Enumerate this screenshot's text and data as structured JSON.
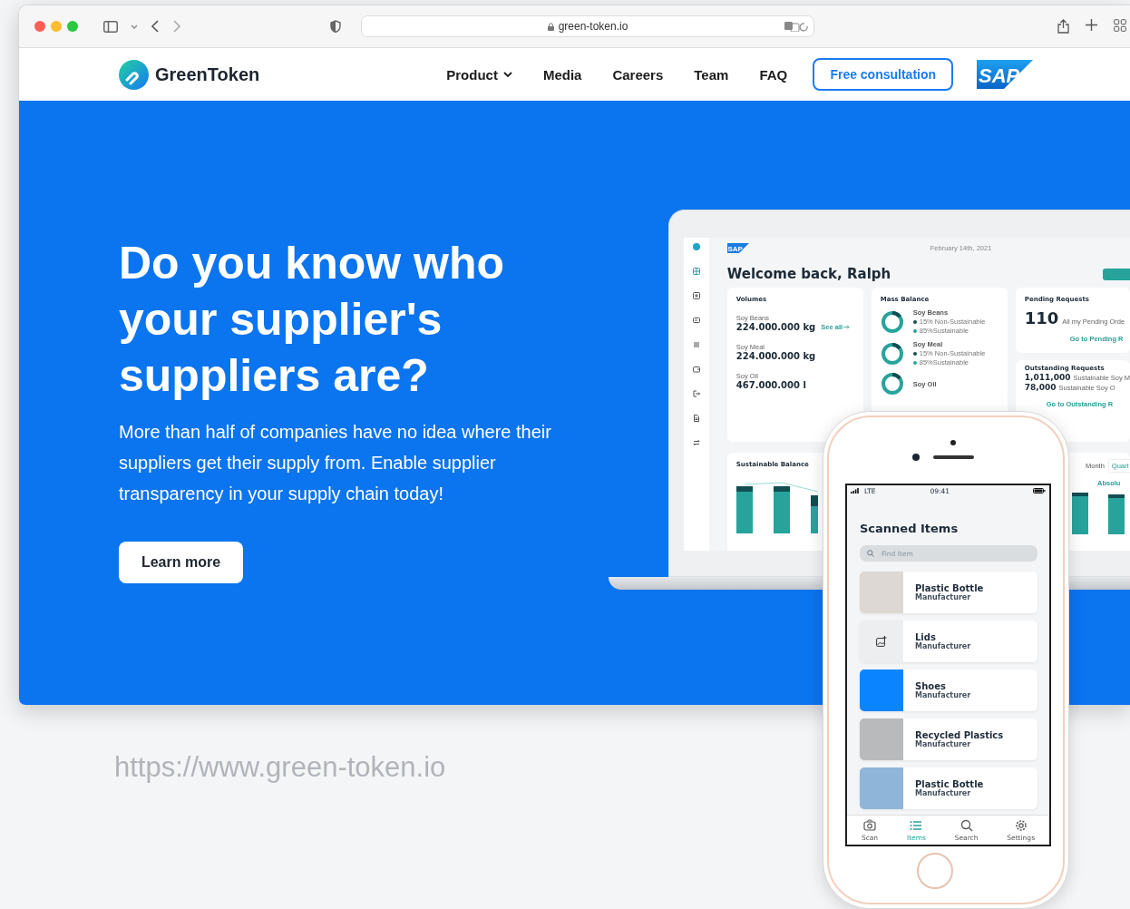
{
  "browser": {
    "url": "green-token.io"
  },
  "nav": {
    "brand": "GreenToken",
    "links": [
      {
        "label": "Product",
        "dropdown": true
      },
      {
        "label": "Media",
        "dropdown": false
      },
      {
        "label": "Careers",
        "dropdown": false
      },
      {
        "label": "Team",
        "dropdown": false
      },
      {
        "label": "FAQ",
        "dropdown": false
      }
    ],
    "cta": "Free consultation",
    "partner_logo": "SAP"
  },
  "hero": {
    "headline": "Do you know who your supplier's suppliers are?",
    "body": "More than half of companies have no idea where their suppliers get their supply from. Enable supplier transparency in your supply chain today!",
    "button": "Learn more"
  },
  "dashboard": {
    "logo": "SAP",
    "date": "February 14th, 2021",
    "title": "Welcome back, Ralph",
    "sidebar": [
      {
        "kind": "grid",
        "selected": true
      },
      {
        "kind": "plus",
        "selected": false
      },
      {
        "kind": "card",
        "selected": false
      },
      {
        "kind": "list",
        "selected": false
      },
      {
        "kind": "wallet",
        "selected": false
      },
      {
        "kind": "exit",
        "selected": false
      },
      {
        "kind": "doc",
        "selected": false
      },
      {
        "kind": "swap",
        "selected": false
      }
    ],
    "volumes": {
      "title": "Volumes",
      "link": "See all",
      "items": [
        {
          "label": "Soy Beans",
          "value": "224.000.000 kg"
        },
        {
          "label": "Soy Meal",
          "value": "224.000.000 kg"
        },
        {
          "label": "Soy Oil",
          "value": "467.000.000 l"
        }
      ]
    },
    "mass_balance": {
      "title": "Mass Balance",
      "items": [
        {
          "label": "Soy Beans",
          "level": 0.15,
          "legend": [
            "15% Non-Sustainable",
            "85%Sustainable"
          ]
        },
        {
          "label": "Soy Meal",
          "level": 0.15,
          "legend": [
            "15% Non-Sustainable",
            "85%Sustainable"
          ]
        },
        {
          "label": "Soy Oil",
          "level": 0.15
        }
      ]
    },
    "pending": {
      "title": "Pending Requests",
      "count": "110",
      "caption": "All my Pending Orde",
      "link": "Go to Pending R"
    },
    "outstanding": {
      "title": "Outstanding Requests",
      "rows": [
        {
          "value": "1,011,000",
          "caption": "Sustainable Soy M"
        },
        {
          "value": "78,000",
          "caption": "Sustainable Soy O"
        }
      ],
      "link": "Go to Outstanding R"
    },
    "balance": {
      "title": "Sustainable Balance"
    },
    "periods": [
      {
        "label": "Month",
        "selected": false
      },
      {
        "label": "Quart",
        "selected": true
      }
    ],
    "mode": "Absolu"
  },
  "phone": {
    "carrier": "LTE",
    "time": "09:41",
    "title": "Scanned Items",
    "search": {
      "placeholder": "Find Item"
    },
    "items": [
      {
        "title": "Plastic Bottle",
        "subtitle": "Manufacturer",
        "kind": "photo",
        "color": "#ddd8d3"
      },
      {
        "title": "Lids",
        "subtitle": "Manufacturer",
        "kind": "add-image",
        "color": "#eceef0"
      },
      {
        "title": "Shoes",
        "subtitle": "Manufacturer",
        "kind": "photo",
        "color": "#0a84ff"
      },
      {
        "title": "Recycled Plastics",
        "subtitle": "Manufacturer",
        "kind": "photo",
        "color": "#b9babb"
      },
      {
        "title": "Plastic Bottle",
        "subtitle": "Manufacturer",
        "kind": "photo",
        "color": "#8fb6d8"
      }
    ],
    "tabs": [
      {
        "kind": "camera",
        "label": "Scan",
        "selected": false
      },
      {
        "kind": "list",
        "label": "Items",
        "selected": true
      },
      {
        "kind": "search",
        "label": "Search",
        "selected": false
      },
      {
        "kind": "gear",
        "label": "Settings",
        "selected": false
      }
    ]
  },
  "caption": "https://www.green-token.io"
}
